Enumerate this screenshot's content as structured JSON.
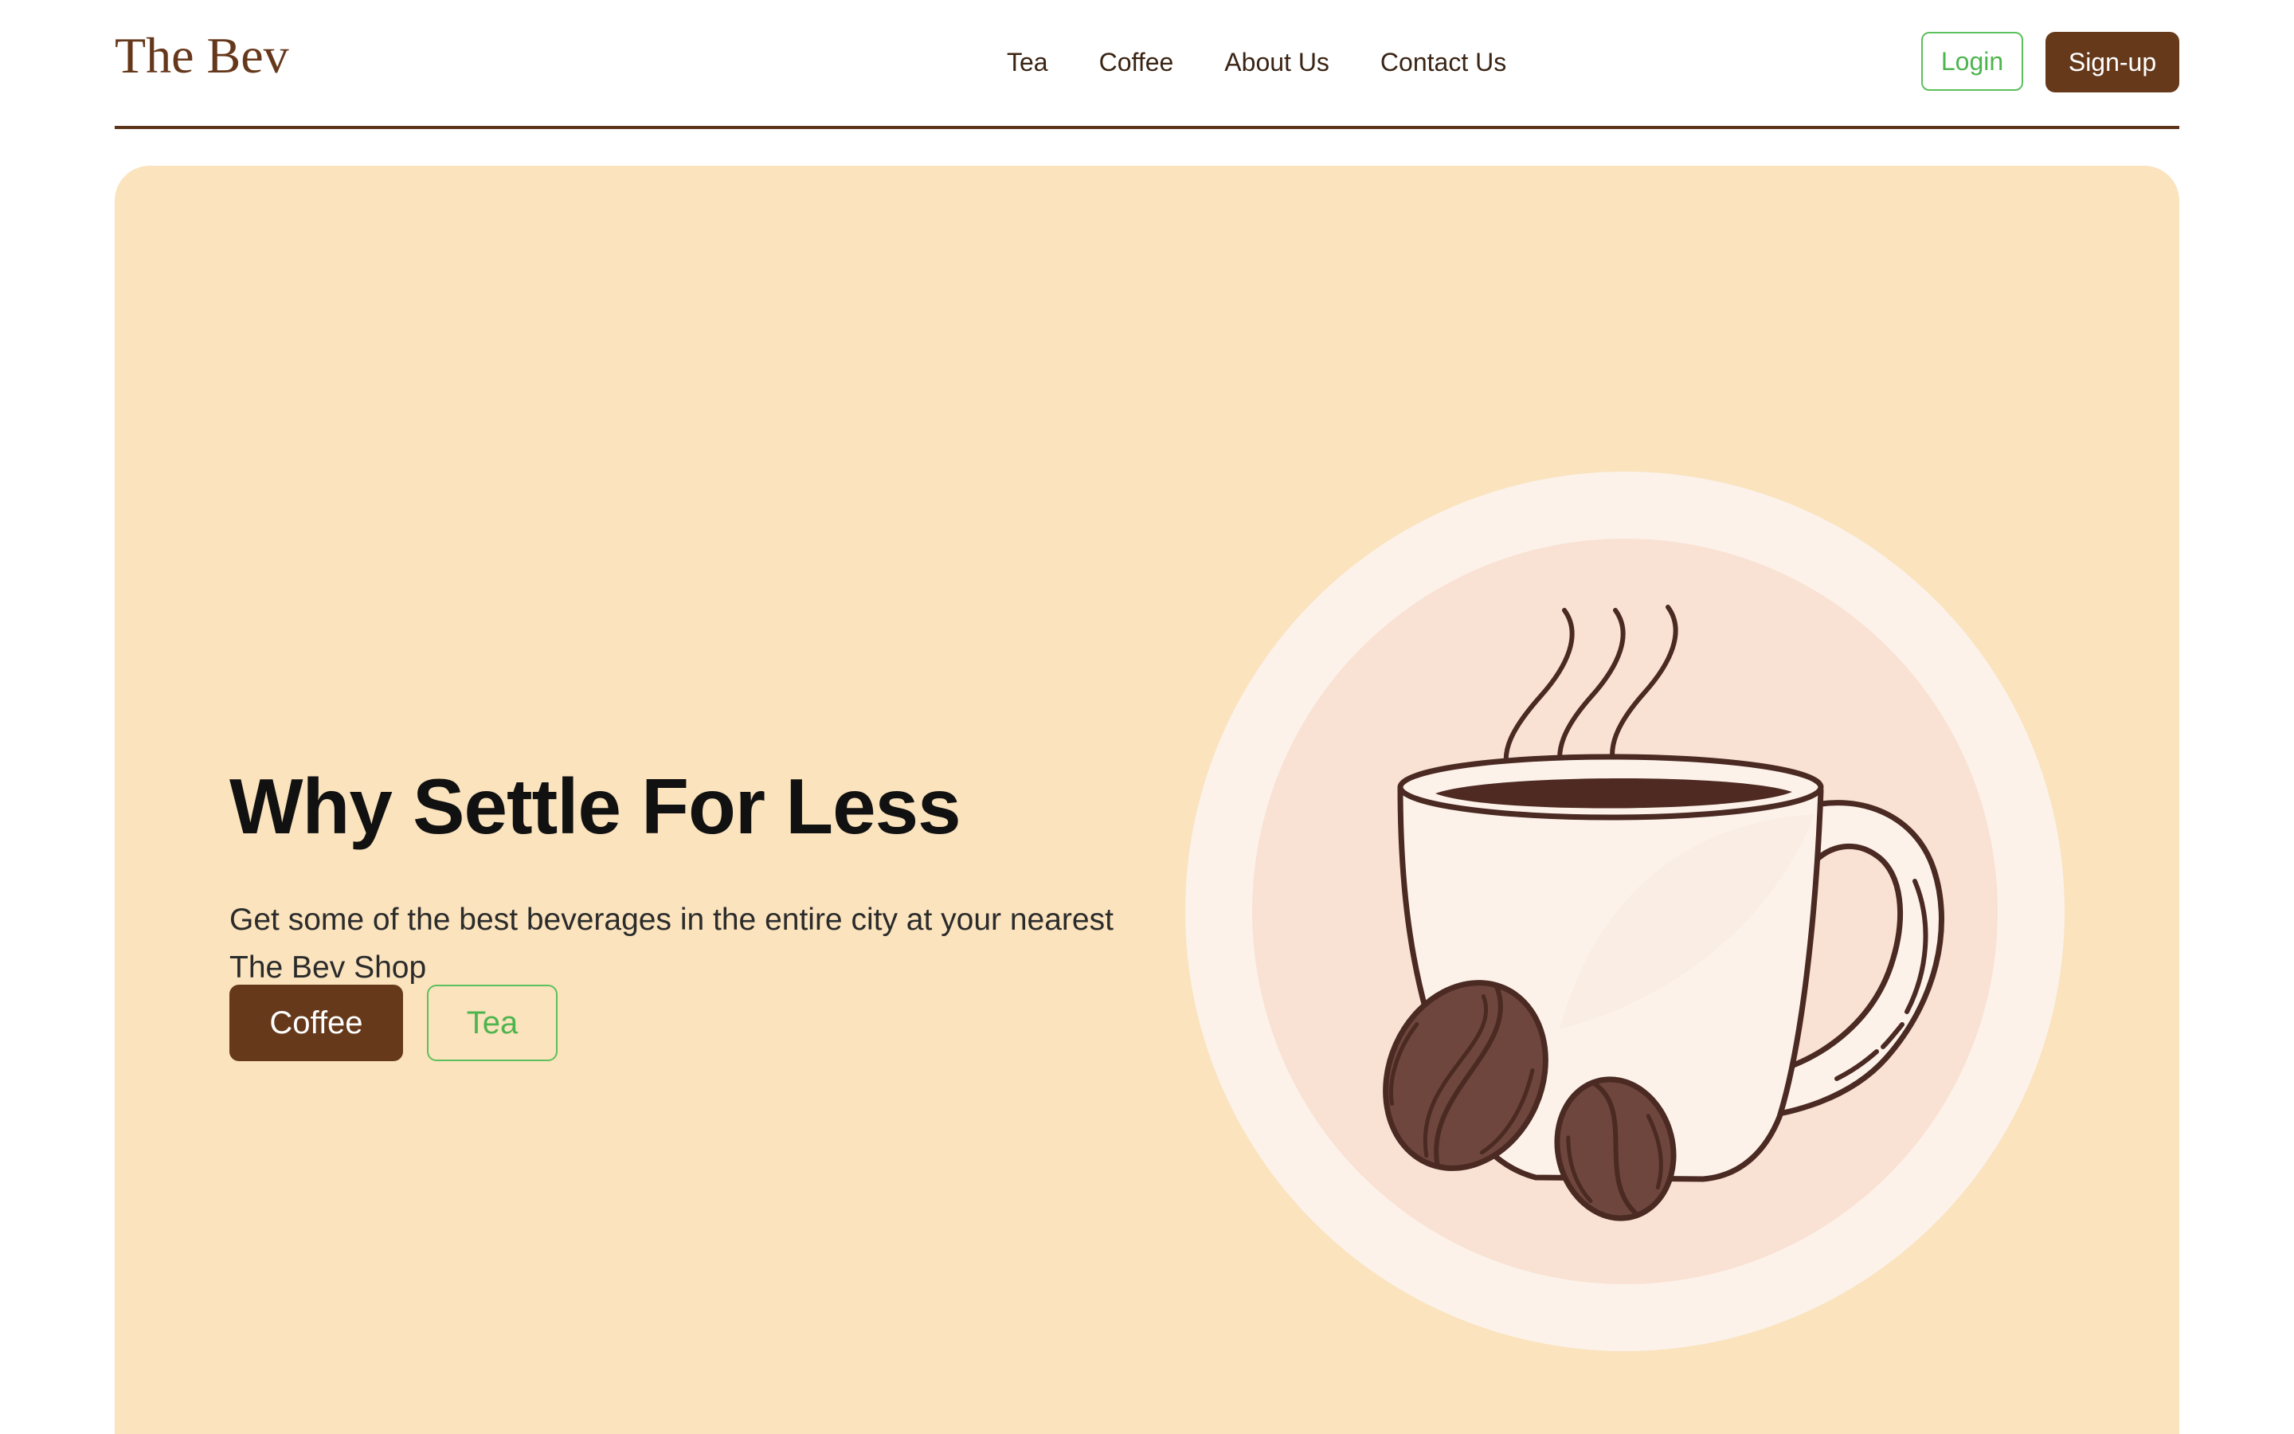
{
  "header": {
    "logo": "The Bev",
    "nav": [
      "Tea",
      "Coffee",
      "About Us",
      "Contact Us"
    ],
    "login_label": "Login",
    "signup_label": "Sign-up"
  },
  "hero": {
    "title": "Why Settle For Less",
    "subtitle": "Get some of the best beverages in the entire city at your nearest The Bev Shop",
    "primary_button": "Coffee",
    "secondary_button": "Tea",
    "illustration_icon": "coffee-cup-with-beans-icon"
  },
  "colors": {
    "brand_brown": "#66391b",
    "accent_green": "#4eb44e",
    "hero_background": "#fae3bd"
  }
}
